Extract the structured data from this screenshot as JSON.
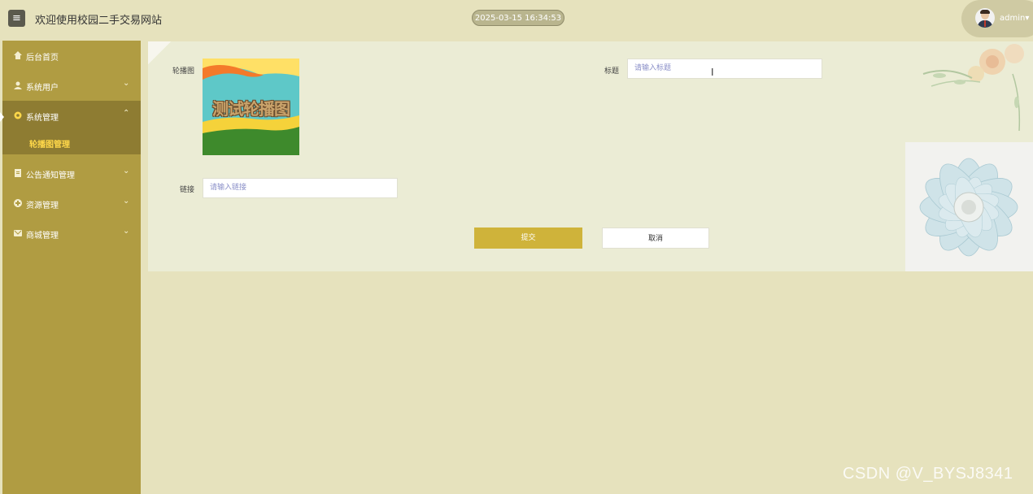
{
  "header": {
    "menu_icon": "hamburger-icon",
    "title": "欢迎使用校园二手交易网站",
    "datetime": "2025-03-15 16:34:53",
    "user": "admin",
    "user_caret": "▾"
  },
  "sidebar": {
    "items": [
      {
        "label": "后台首页",
        "icon": "home-icon",
        "chevron": ""
      },
      {
        "label": "系统用户",
        "icon": "user-icon",
        "chevron": "⌄"
      },
      {
        "label": "系统管理",
        "icon": "gear-icon",
        "chevron": "⌃"
      },
      {
        "label": "公告通知管理",
        "icon": "document-icon",
        "chevron": "⌄"
      },
      {
        "label": "资源管理",
        "icon": "plus-circle-icon",
        "chevron": "⌄"
      },
      {
        "label": "商城管理",
        "icon": "mail-icon",
        "chevron": "⌄"
      }
    ],
    "sub_item": "轮播图管理"
  },
  "form": {
    "image_label": "轮播图",
    "image_text": "测试轮播图",
    "title_label": "标题",
    "title_placeholder": "请输入标题",
    "link_label": "链接",
    "link_placeholder": "请输入链接",
    "submit": "提交",
    "cancel": "取消"
  },
  "watermark": "CSDN @V_BYSJ8341",
  "colors": {
    "sidebar": "#b09c42",
    "sidebar_active": "#8e7c32",
    "submit": "#cfb33a",
    "background": "#e6e2bd"
  }
}
